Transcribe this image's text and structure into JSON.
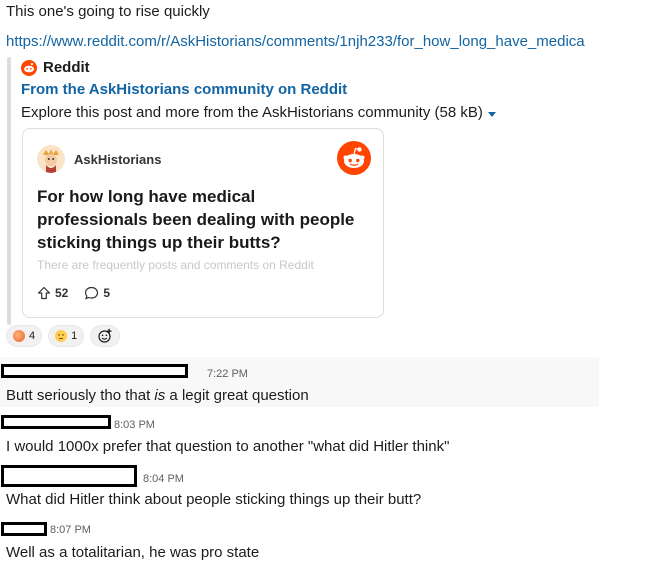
{
  "intro_message": "This one's going to rise quickly",
  "link_url": "https://www.reddit.com/r/AskHistorians/comments/1njh233/for_how_long_have_medica",
  "unfurl": {
    "site_name": "Reddit",
    "title": "From the AskHistorians community on Reddit",
    "description": "Explore this post and more from the AskHistorians community (58 kB)",
    "card": {
      "subreddit": "AskHistorians",
      "post_title": "For how long have medical professionals been dealing with people sticking things up their butts?",
      "snippet": "There are frequently posts and comments on Reddit",
      "upvotes": "52",
      "comments": "5"
    }
  },
  "reactions": [
    {
      "emoji": "peach",
      "count": "4",
      "color": "#f4a24c"
    },
    {
      "emoji": "expressionless-face",
      "count": "1",
      "color": "#ffcc4d"
    }
  ],
  "add_reaction_icon": "add-emoji-icon",
  "messages": [
    {
      "timestamp": "7:22 PM",
      "text_before": "Butt seriously tho that ",
      "text_em": "is",
      "text_after": " a legit great question"
    },
    {
      "timestamp": "8:03 PM",
      "text": "I would 1000x prefer that question to another \"what did Hitler think\""
    },
    {
      "timestamp": "8:04 PM",
      "text": "What did Hitler think about people sticking things up their butt?"
    },
    {
      "timestamp": "8:07 PM",
      "text": "Well as a totalitarian, he was pro state"
    }
  ],
  "colors": {
    "link": "#1264a3",
    "reddit_orange": "#ff4500",
    "hover_bg": "#f8f8f8"
  }
}
